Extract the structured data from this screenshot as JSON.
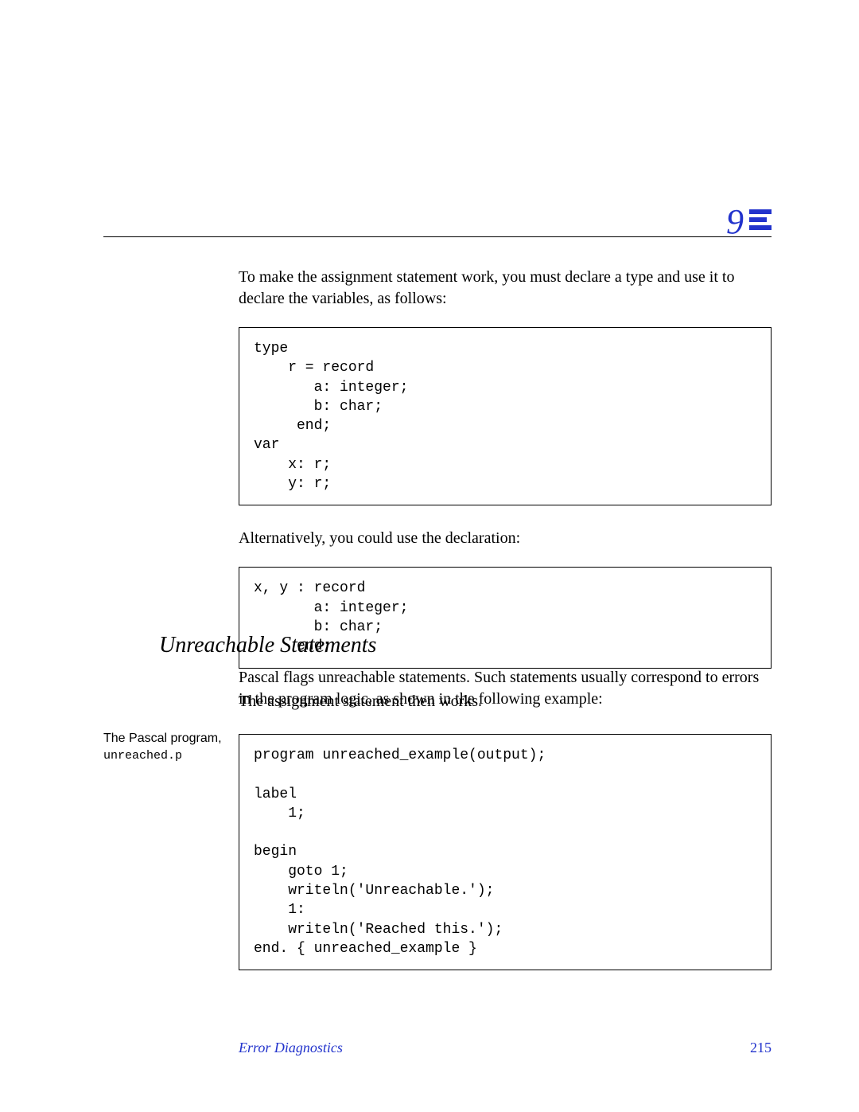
{
  "chapter_number": "9",
  "body": {
    "para1": "To make the assignment statement work, you must declare a type and use it to declare the variables, as follows:",
    "code1": "type\n    r = record\n       a: integer;\n       b: char;\n     end;\nvar\n    x: r;\n    y: r;",
    "para2": "Alternatively, you could use the declaration:",
    "code2": "x, y : record\n       a: integer;\n       b: char;\n     end;",
    "para3": "The assignment statement then works."
  },
  "section_heading": "Unreachable Statements",
  "section_para": "Pascal flags unreachable statements.  Such statements usually correspond to errors in the program logic, as shown in the following example:",
  "caption": {
    "line1": "The Pascal program,",
    "filename": "unreached.p"
  },
  "code3": "program unreached_example(output);\n\nlabel\n    1;\n\nbegin\n    goto 1;\n    writeln('Unreachable.');\n    1:\n    writeln('Reached this.');\nend. { unreached_example }",
  "footer": {
    "title": "Error Diagnostics",
    "page": "215"
  }
}
